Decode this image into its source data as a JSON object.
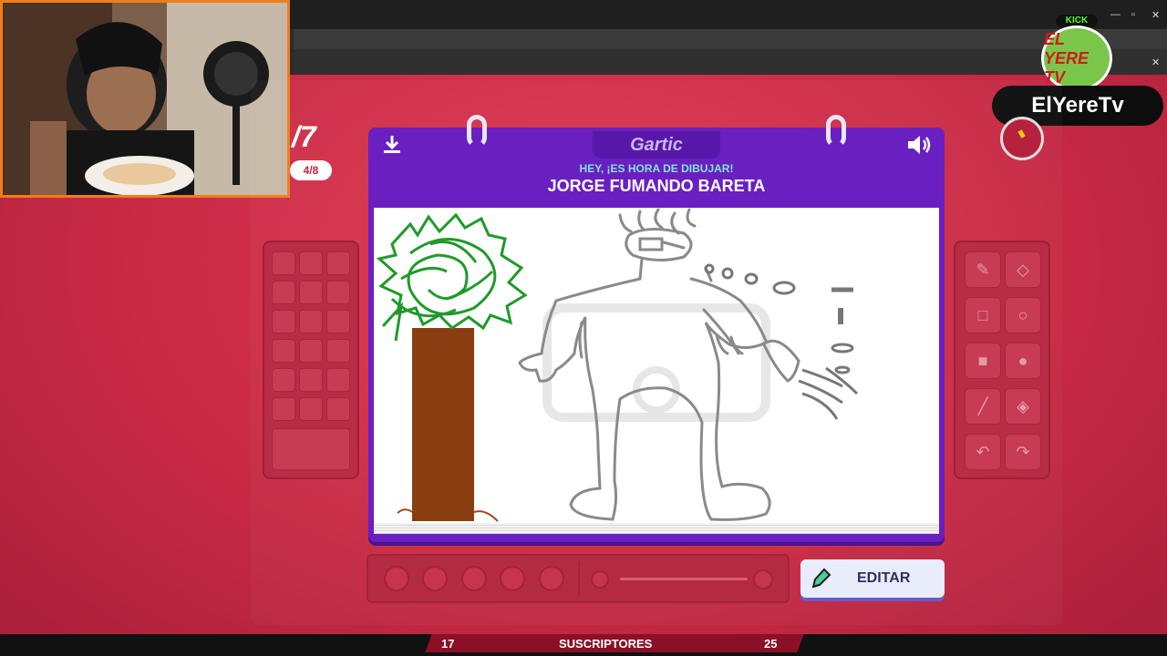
{
  "stream": {
    "platform_badge": "KICK",
    "channel_logo_text": "EL YERE TV",
    "channel_name": "ElYereTv",
    "subscribers_label": "SUSCRIPTORES",
    "subscribers_current": "17",
    "subscribers_goal": "25"
  },
  "game": {
    "round_fraction": "/7",
    "round_pill": "4/8",
    "logo": "Gartic",
    "hint": "HEY, ¡ES HORA DE DIBUJAR!",
    "subject": "JORGE FUMANDO BARETA",
    "edit_button": "EDITAR",
    "watermark": "Gartic PHONE"
  },
  "icons": {
    "download": "download-icon",
    "sound": "speaker-icon",
    "edit": "pencil-icon",
    "timer": "timer-icon"
  },
  "colors": {
    "background": "#d3324b",
    "notebook": "#6a1fc0",
    "webcam_border": "#f07d1a",
    "accent_teal": "#7fe7d6"
  }
}
